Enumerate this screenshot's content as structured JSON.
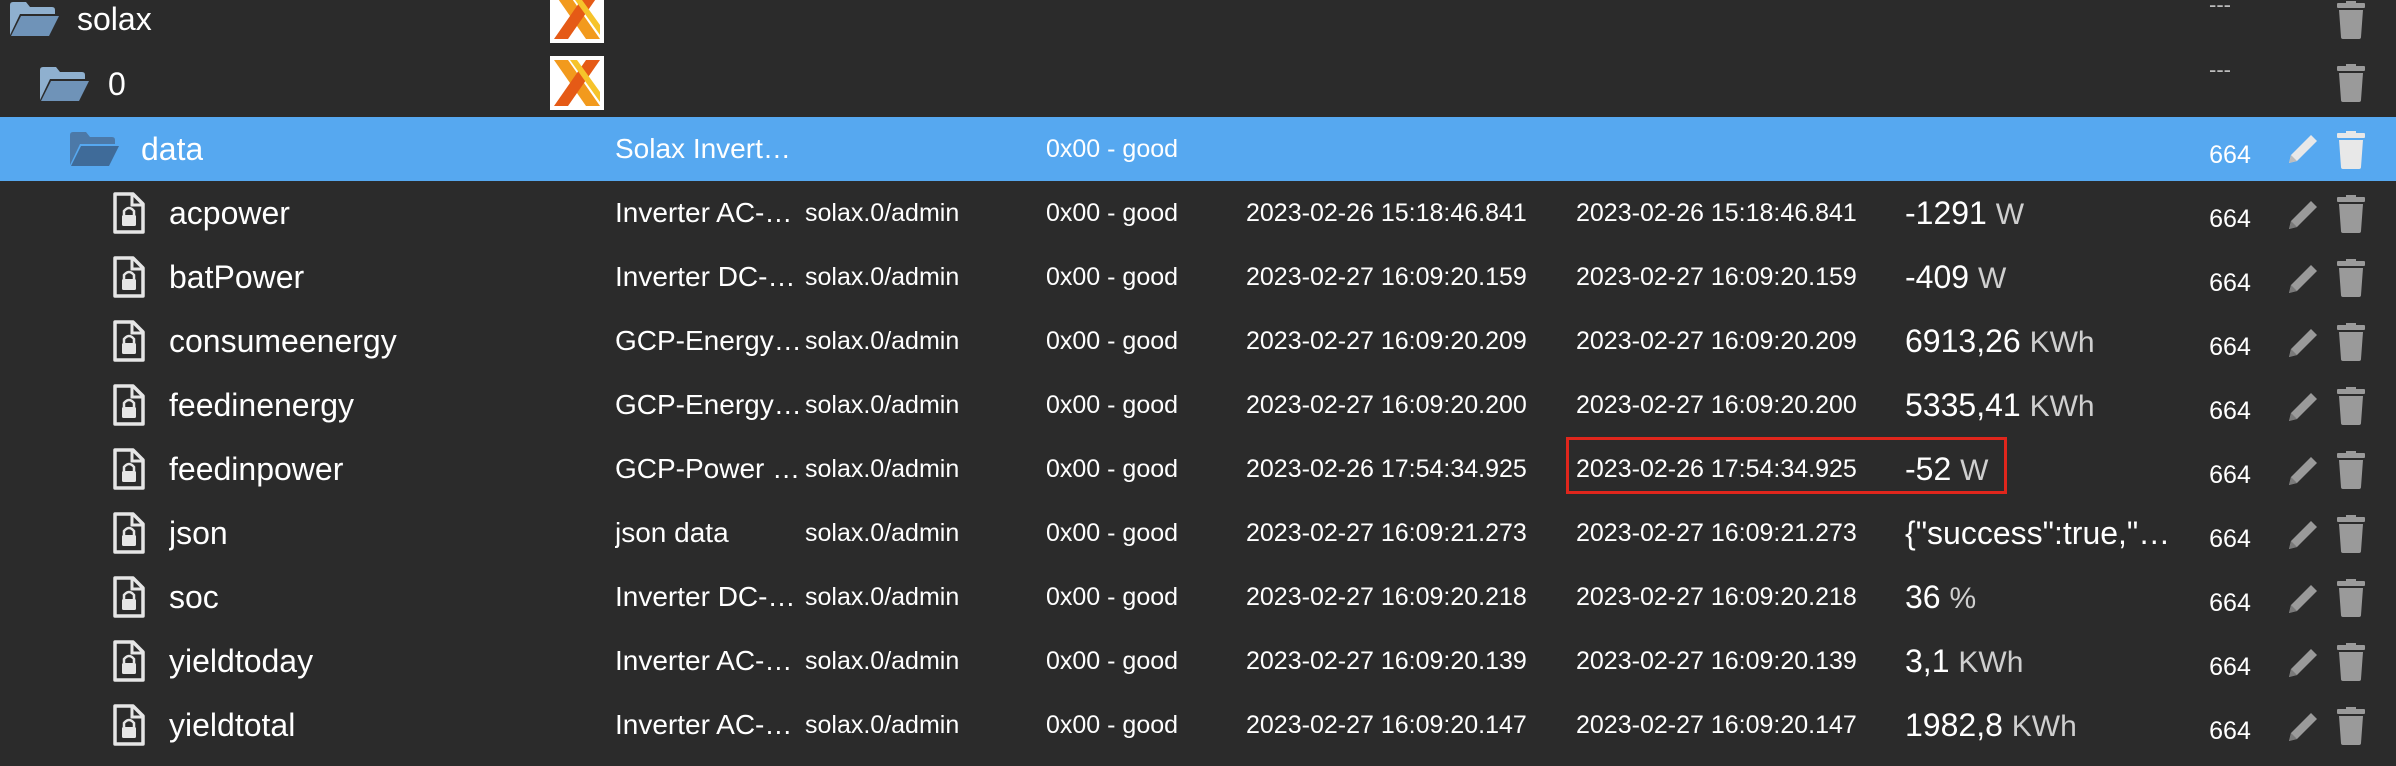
{
  "tree": {
    "root_folder": {
      "name": "solax",
      "rights": "---"
    },
    "instance_folder": {
      "name": "0",
      "rights": "---"
    },
    "data_folder": {
      "name": "data",
      "description": "Solax Inverte…",
      "ack": "0x00 - good",
      "rights": "664"
    },
    "states": [
      {
        "name": "acpower",
        "description": "Inverter AC-P…",
        "role": "solax.0/admin",
        "ack": "0x00 - good",
        "ts": "2023-02-26 15:18:46.841",
        "lc": "2023-02-26 15:18:46.841",
        "value": "-1291",
        "unit": "W",
        "rights": "664"
      },
      {
        "name": "batPower",
        "description": "Inverter DC-…",
        "role": "solax.0/admin",
        "ack": "0x00 - good",
        "ts": "2023-02-27 16:09:20.159",
        "lc": "2023-02-27 16:09:20.159",
        "value": "-409",
        "unit": "W",
        "rights": "664"
      },
      {
        "name": "consumeenergy",
        "description": "GCP-Energy f…",
        "role": "solax.0/admin",
        "ack": "0x00 - good",
        "ts": "2023-02-27 16:09:20.209",
        "lc": "2023-02-27 16:09:20.209",
        "value": "6913,26",
        "unit": "KWh",
        "rights": "664"
      },
      {
        "name": "feedinenergy",
        "description": "GCP-Energy t…",
        "role": "solax.0/admin",
        "ack": "0x00 - good",
        "ts": "2023-02-27 16:09:20.200",
        "lc": "2023-02-27 16:09:20.200",
        "value": "5335,41",
        "unit": "KWh",
        "rights": "664"
      },
      {
        "name": "feedinpower",
        "description": "GCP-Power t…",
        "role": "solax.0/admin",
        "ack": "0x00 - good",
        "ts": "2023-02-26 17:54:34.925",
        "lc": "2023-02-26 17:54:34.925",
        "value": "-52",
        "unit": "W",
        "rights": "664"
      },
      {
        "name": "json",
        "description": "json data",
        "role": "solax.0/admin",
        "ack": "0x00 - good",
        "ts": "2023-02-27 16:09:21.273",
        "lc": "2023-02-27 16:09:21.273",
        "value": "{\"success\":true,\"…",
        "unit": "",
        "rights": "664"
      },
      {
        "name": "soc",
        "description": "Inverter DC-…",
        "role": "solax.0/admin",
        "ack": "0x00 - good",
        "ts": "2023-02-27 16:09:20.218",
        "lc": "2023-02-27 16:09:20.218",
        "value": "36",
        "unit": "%",
        "rights": "664"
      },
      {
        "name": "yieldtoday",
        "description": "Inverter AC-E…",
        "role": "solax.0/admin",
        "ack": "0x00 - good",
        "ts": "2023-02-27 16:09:20.139",
        "lc": "2023-02-27 16:09:20.139",
        "value": "3,1",
        "unit": "KWh",
        "rights": "664"
      },
      {
        "name": "yieldtotal",
        "description": "Inverter AC-E…",
        "role": "solax.0/admin",
        "ack": "0x00 - good",
        "ts": "2023-02-27 16:09:20.147",
        "lc": "2023-02-27 16:09:20.147",
        "value": "1982,8",
        "unit": "KWh",
        "rights": "664"
      }
    ]
  },
  "icons": {
    "folder": "folder-open-icon",
    "state": "file-lock-icon",
    "adapter": "solax-logo-icon",
    "edit": "pencil-icon",
    "delete": "trash-icon"
  },
  "colors": {
    "background": "#2b2b2b",
    "selected_row": "#56a8f0",
    "folder_icon": "#8fb0cf",
    "highlight_border": "#e0261c"
  }
}
